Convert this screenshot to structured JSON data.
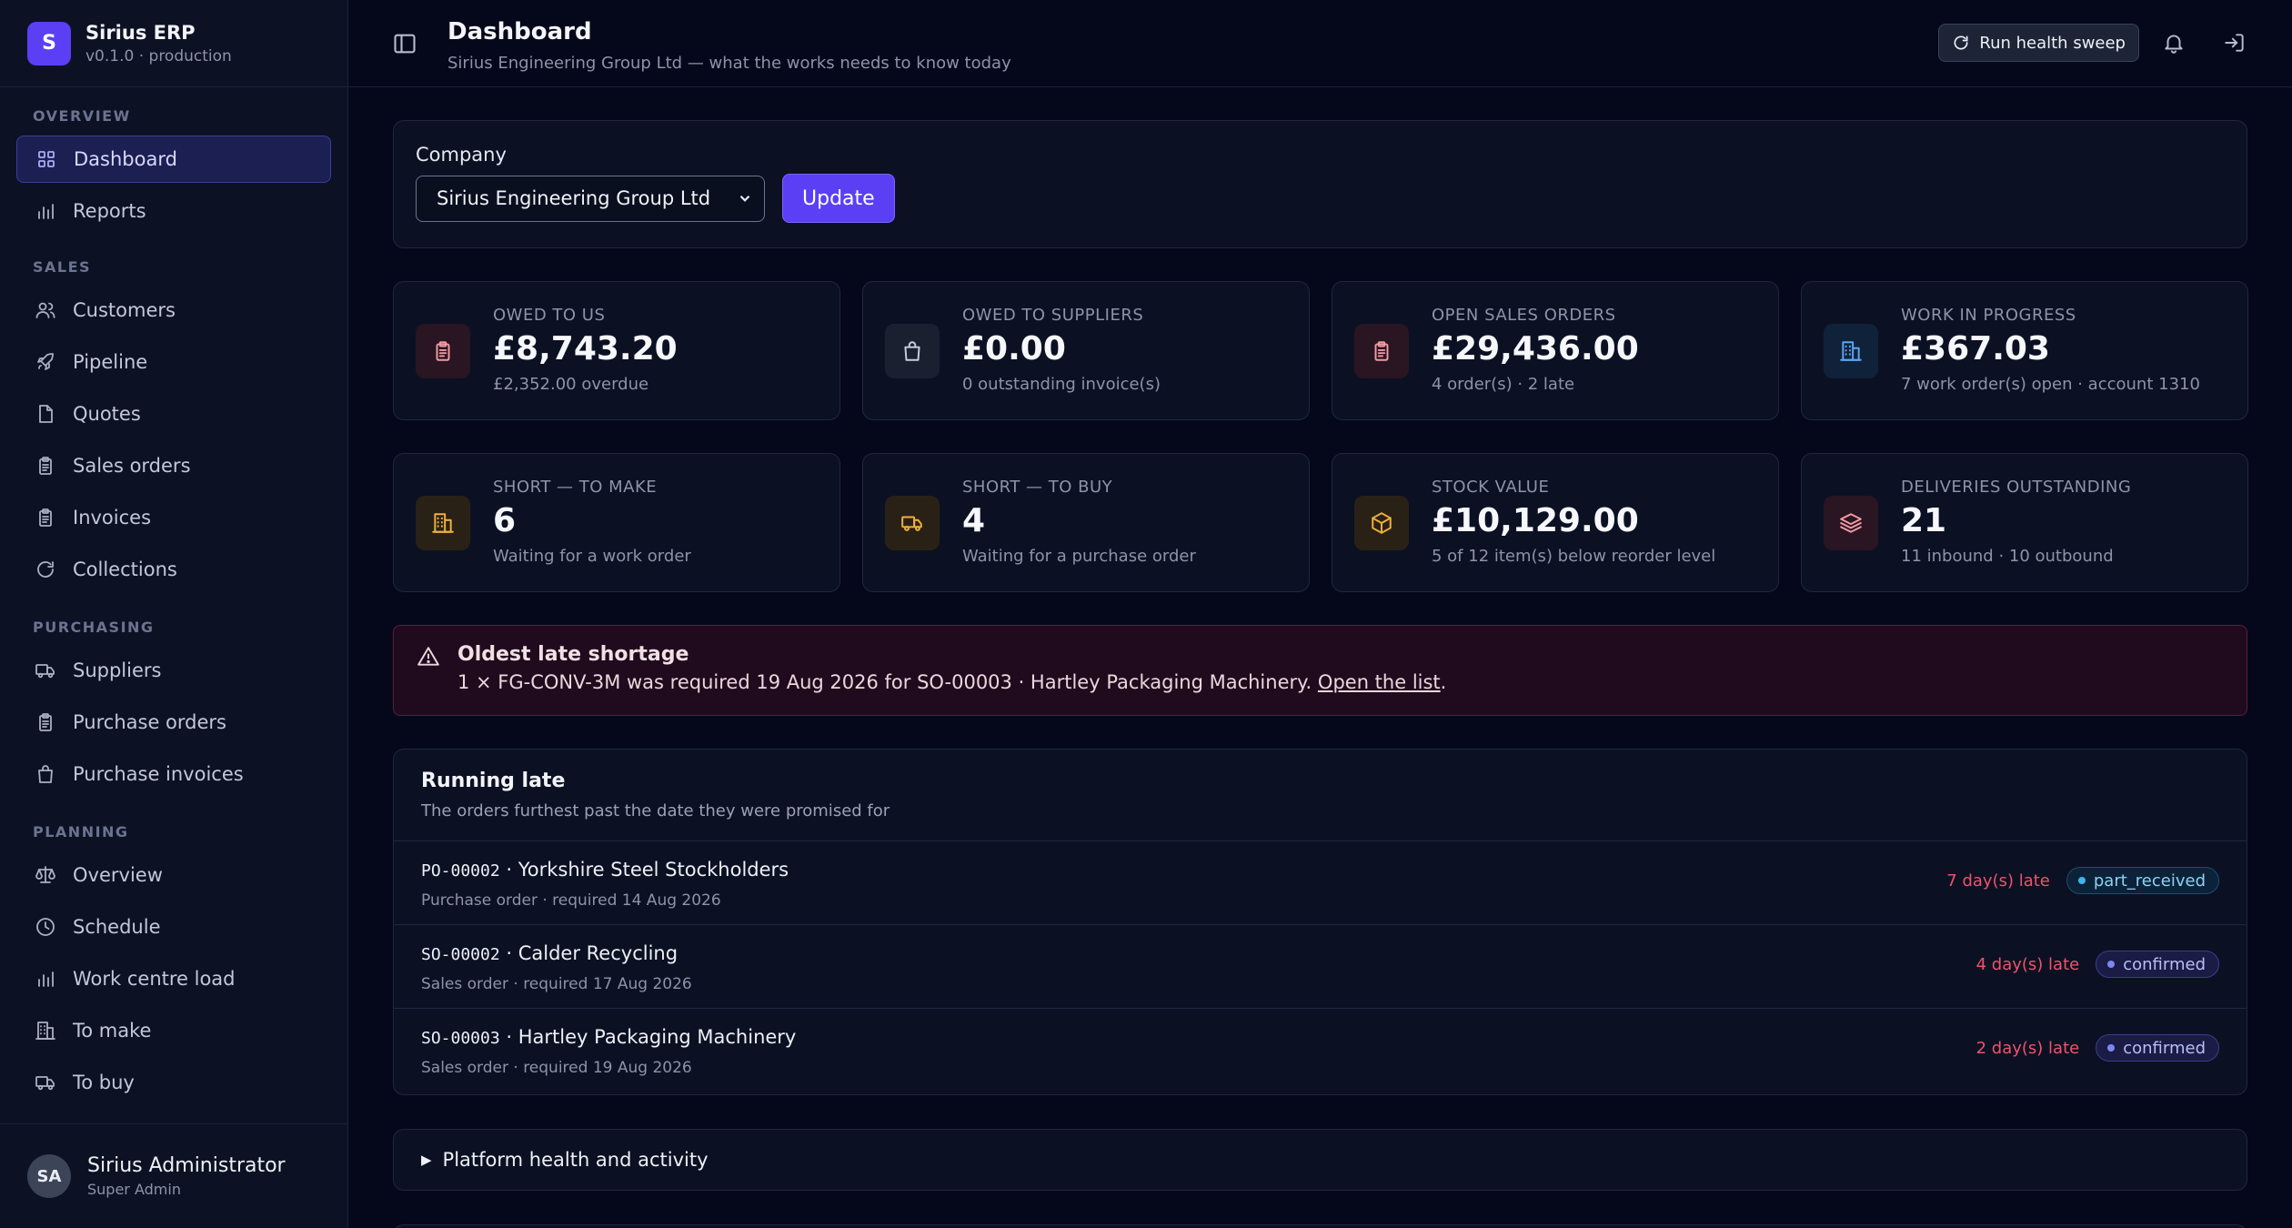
{
  "brand": {
    "logo_letter": "S",
    "name": "Sirius ERP",
    "version": "v0.1.0 · production"
  },
  "sidebar": {
    "sections": [
      {
        "title": "OVERVIEW",
        "items": [
          {
            "label": "Dashboard",
            "icon": "grid-icon",
            "active": true
          },
          {
            "label": "Reports",
            "icon": "bar-chart-icon"
          }
        ]
      },
      {
        "title": "SALES",
        "items": [
          {
            "label": "Customers",
            "icon": "users-icon"
          },
          {
            "label": "Pipeline",
            "icon": "rocket-icon"
          },
          {
            "label": "Quotes",
            "icon": "document-icon"
          },
          {
            "label": "Sales orders",
            "icon": "clipboard-icon"
          },
          {
            "label": "Invoices",
            "icon": "clipboard-icon"
          },
          {
            "label": "Collections",
            "icon": "refresh-icon"
          }
        ]
      },
      {
        "title": "PURCHASING",
        "items": [
          {
            "label": "Suppliers",
            "icon": "truck-icon"
          },
          {
            "label": "Purchase orders",
            "icon": "clipboard-icon"
          },
          {
            "label": "Purchase invoices",
            "icon": "shopping-bag-icon"
          }
        ]
      },
      {
        "title": "PLANNING",
        "items": [
          {
            "label": "Overview",
            "icon": "scale-icon"
          },
          {
            "label": "Schedule",
            "icon": "clock-icon"
          },
          {
            "label": "Work centre load",
            "icon": "bar-chart-icon"
          },
          {
            "label": "To make",
            "icon": "building-icon"
          },
          {
            "label": "To buy",
            "icon": "truck-icon"
          }
        ]
      }
    ],
    "user": {
      "initials": "SA",
      "name": "Sirius Administrator",
      "role": "Super Admin"
    }
  },
  "header": {
    "title": "Dashboard",
    "subtitle": "Sirius Engineering Group Ltd — what the works needs to know today",
    "sweep_label": "Run health sweep"
  },
  "company": {
    "label": "Company",
    "selected": "Sirius Engineering Group Ltd",
    "update_label": "Update"
  },
  "stats": [
    {
      "label": "OWED TO US",
      "value": "£8,743.20",
      "note": "£2,352.00 overdue",
      "icon": "clipboard-icon",
      "color": "#f29aa3",
      "bg": "#2a1522"
    },
    {
      "label": "OWED TO SUPPLIERS",
      "value": "£0.00",
      "note": "0 outstanding invoice(s)",
      "icon": "shopping-bag-icon",
      "color": "#c9cede",
      "bg": "#1a2030"
    },
    {
      "label": "OPEN SALES ORDERS",
      "value": "£29,436.00",
      "note": "4 order(s) · 2 late",
      "icon": "clipboard-icon",
      "color": "#f29aa3",
      "bg": "#2a1522"
    },
    {
      "label": "WORK IN PROGRESS",
      "value": "£367.03",
      "note": "7 work order(s) open · account 1310",
      "icon": "building-icon",
      "color": "#5da7f2",
      "bg": "#10223a"
    },
    {
      "label": "SHORT — TO MAKE",
      "value": "6",
      "note": "Waiting for a work order",
      "icon": "building-icon",
      "color": "#f0b23a",
      "bg": "#2a2116"
    },
    {
      "label": "SHORT — TO BUY",
      "value": "4",
      "note": "Waiting for a purchase order",
      "icon": "truck-icon",
      "color": "#f0b23a",
      "bg": "#2a2116"
    },
    {
      "label": "STOCK VALUE",
      "value": "£10,129.00",
      "note": "5 of 12 item(s) below reorder level",
      "icon": "box-icon",
      "color": "#f0b23a",
      "bg": "#2a2116"
    },
    {
      "label": "DELIVERIES OUTSTANDING",
      "value": "21",
      "note": "11 inbound · 10 outbound",
      "icon": "layers-icon",
      "color": "#f29aa3",
      "bg": "#2a1522"
    }
  ],
  "alert": {
    "title": "Oldest late shortage",
    "body": "1 × FG-CONV-3M was required 19 Aug 2026 for SO-00003 · Hartley Packaging Machinery. ",
    "link": "Open the list",
    "tail": "."
  },
  "late": {
    "title": "Running late",
    "subtitle": "The orders furthest past the date they were promised for",
    "rows": [
      {
        "ref": "PO-00002",
        "name": " · Yorkshire Steel Stockholders",
        "meta": "Purchase order · required 14 Aug 2026",
        "late": "7 day(s) late",
        "status": "part_received",
        "kind": "part"
      },
      {
        "ref": "SO-00002",
        "name": " · Calder Recycling",
        "meta": "Sales order · required 17 Aug 2026",
        "late": "4 day(s) late",
        "status": "confirmed",
        "kind": "conf"
      },
      {
        "ref": "SO-00003",
        "name": " · Hartley Packaging Machinery",
        "meta": "Sales order · required 19 Aug 2026",
        "late": "2 day(s) late",
        "status": "confirmed",
        "kind": "conf"
      }
    ]
  },
  "health": {
    "label": "Platform health and activity"
  }
}
